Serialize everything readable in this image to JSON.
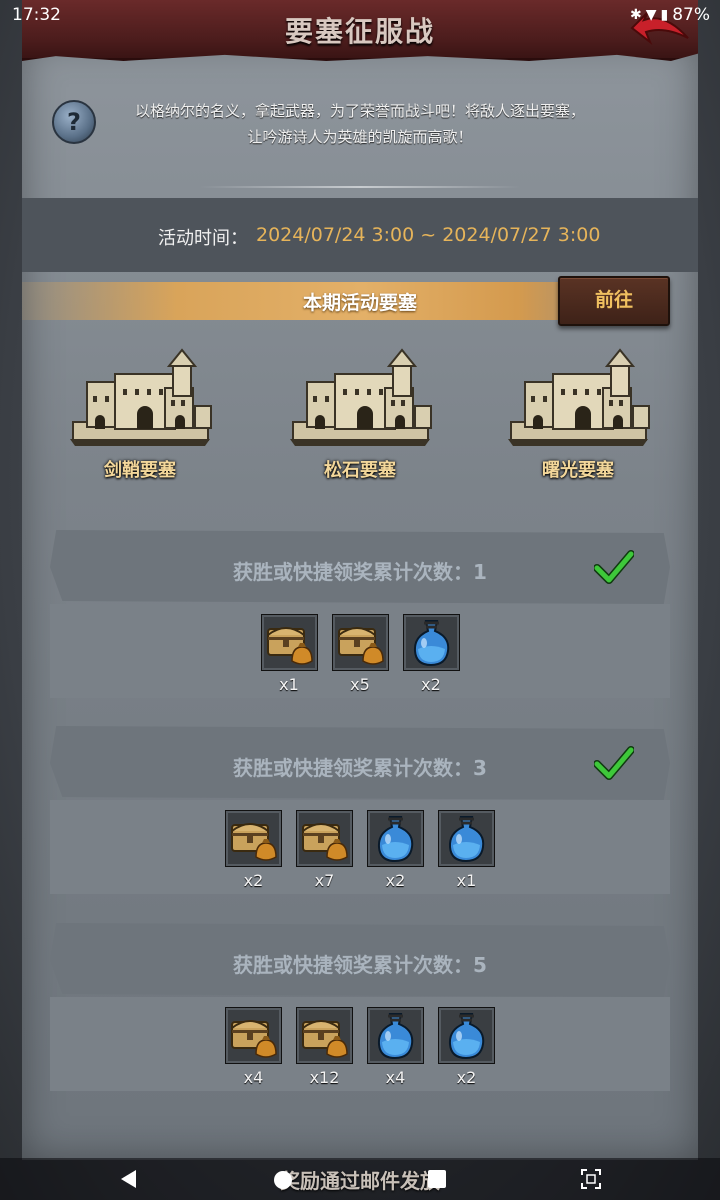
{
  "status_bar": {
    "time": "17:32",
    "battery": "87%"
  },
  "header": {
    "title": "要塞征服战"
  },
  "description": {
    "line1": "以格纳尔的名义，拿起武器，为了荣誉而战斗吧！将敌人逐出要塞，",
    "line2": "让吟游诗人为英雄的凯旋而高歌！"
  },
  "event_time": {
    "label": "活动时间：",
    "value": "2024/07/24 3:00 ~ 2024/07/27 3:00"
  },
  "section": {
    "title": "本期活动要塞",
    "go_label": "前往"
  },
  "fortresses": [
    {
      "name": "剑鞘要塞"
    },
    {
      "name": "松石要塞"
    },
    {
      "name": "曙光要塞"
    }
  ],
  "tiers": [
    {
      "title": "获胜或快捷领奖累计次数：1",
      "completed": true,
      "rewards": [
        {
          "icon": "treasure-chest-icon",
          "count": "x1"
        },
        {
          "icon": "treasure-chest-icon",
          "count": "x5"
        },
        {
          "icon": "blue-potion-icon",
          "count": "x2"
        }
      ]
    },
    {
      "title": "获胜或快捷领奖累计次数：3",
      "completed": true,
      "rewards": [
        {
          "icon": "treasure-chest-icon",
          "count": "x2"
        },
        {
          "icon": "treasure-chest-icon",
          "count": "x7"
        },
        {
          "icon": "blue-potion-icon",
          "count": "x2"
        },
        {
          "icon": "blue-potion-icon",
          "count": "x1"
        }
      ]
    },
    {
      "title": "获胜或快捷领奖累计次数：5",
      "completed": false,
      "rewards": [
        {
          "icon": "treasure-chest-icon",
          "count": "x4"
        },
        {
          "icon": "treasure-chest-icon",
          "count": "x12"
        },
        {
          "icon": "blue-potion-icon",
          "count": "x4"
        },
        {
          "icon": "blue-potion-icon",
          "count": "x2"
        }
      ]
    }
  ],
  "footer": {
    "note": "奖励通过邮件发放"
  },
  "colors": {
    "accent_gold": "#e6b45a",
    "title_red": "#4b1c1c",
    "check_green": "#3ec83a"
  }
}
